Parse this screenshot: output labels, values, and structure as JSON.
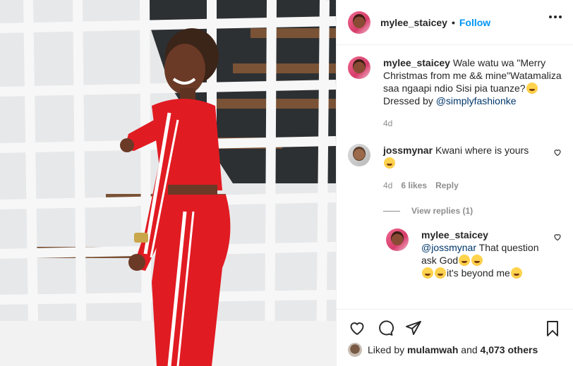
{
  "post": {
    "username": "mylee_staicey",
    "separator": "•",
    "follow_label": "Follow",
    "more_icon": "more-options-icon"
  },
  "caption": {
    "username": "mylee_staicey",
    "text": "Wale watu wa \"Merry Christmas from me && mine\"Watamaliza saa ngaapi ndio Sisi pia tuanze?",
    "emoji": "grinning-face",
    "dressed_by": "Dressed by",
    "mention": "@simplyfashionke",
    "time": "4d"
  },
  "comments": [
    {
      "username": "jossmynar",
      "text": "Kwani where is yours",
      "emoji": "grinning-squinting-face",
      "time": "4d",
      "likes": "6 likes",
      "reply_label": "Reply"
    }
  ],
  "view_replies": "View replies (1)",
  "reply": {
    "username": "mylee_staicey",
    "mention": "@jossmynar",
    "text_1": "That question ask God",
    "text_2": "it's beyond me"
  },
  "likes_line": {
    "prefix": "Liked by",
    "user": "mulamwah",
    "and": "and",
    "count": "4,073 others"
  },
  "icons": [
    "heart-icon",
    "comment-icon",
    "share-icon",
    "bookmark-icon"
  ],
  "colors": {
    "follow": "#0095f6",
    "mention": "#00376b",
    "muted": "#8e8e8e",
    "outfit_red": "#e11b22"
  }
}
